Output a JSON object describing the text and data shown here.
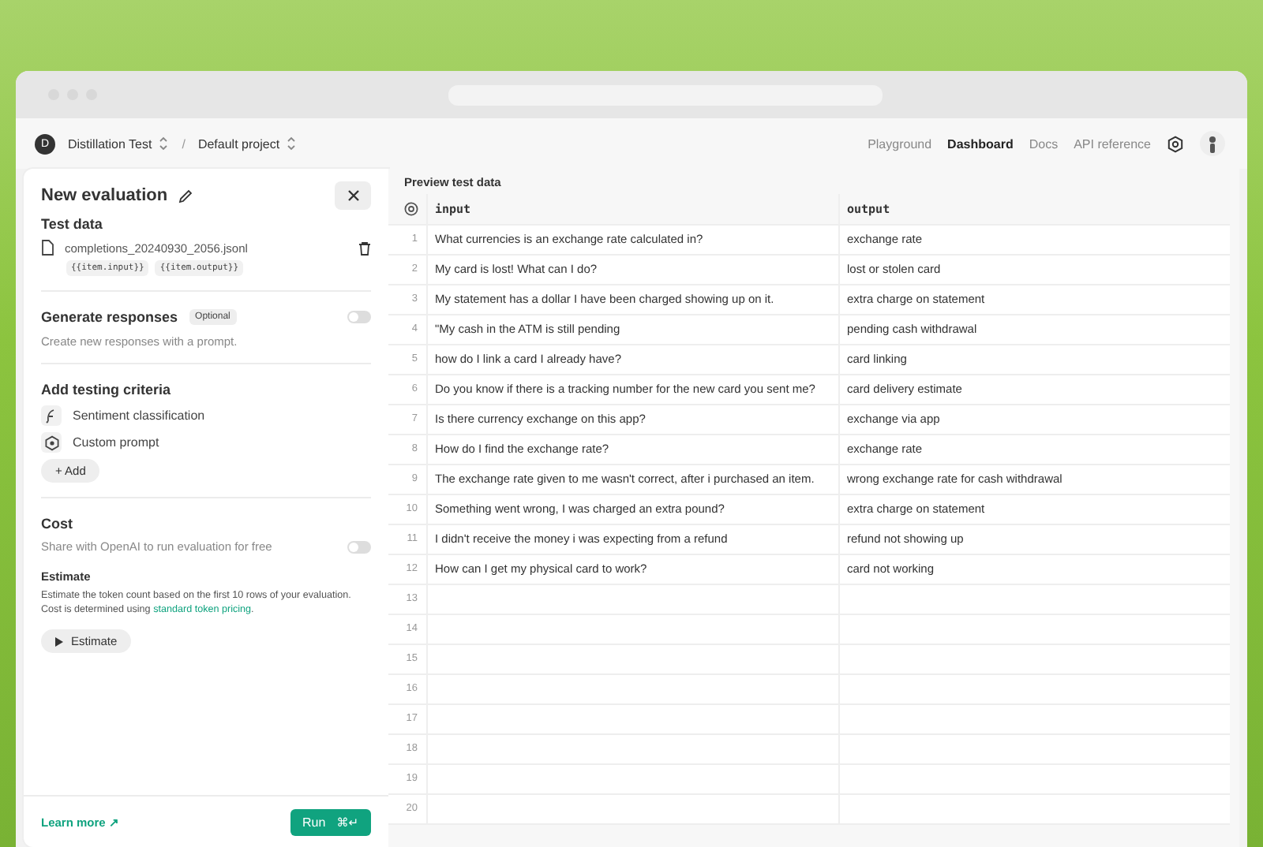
{
  "header": {
    "avatar_letter": "D",
    "organization": "Distillation Test",
    "separator": "/",
    "project": "Default project",
    "nav": [
      {
        "label": "Playground",
        "selected": false
      },
      {
        "label": "Dashboard",
        "selected": true
      },
      {
        "label": "Docs",
        "selected": false
      },
      {
        "label": "API reference",
        "selected": false
      }
    ]
  },
  "panel": {
    "title": "New evaluation",
    "test_data": {
      "heading": "Test data",
      "file": "completions_20240930_2056.jsonl",
      "tags": [
        "{{item.input}}",
        "{{item.output}}"
      ]
    },
    "generate": {
      "heading": "Generate responses",
      "badge": "Optional",
      "on": false,
      "description": "Create new responses with a prompt."
    },
    "criteria": {
      "heading": "Add testing criteria",
      "items": [
        {
          "kind": "sentiment",
          "label": "Sentiment classification"
        },
        {
          "kind": "prompt",
          "label": "Custom prompt"
        }
      ],
      "add_button": "+ Add"
    },
    "cost": {
      "heading": "Cost",
      "share_label": "Share with OpenAI to run evaluation for free",
      "share_on": false,
      "estimate_heading": "Estimate",
      "estimate_text": "Estimate the token count based on the first 10 rows of your evaluation. Cost is determined using ",
      "estimate_link": "standard token pricing",
      "estimate_end": ".",
      "estimate_button": "Estimate"
    },
    "footer": {
      "learn_more": "Learn more ↗",
      "run_button": "Run",
      "run_shortcut": "⌘↵"
    }
  },
  "table": {
    "title": "Preview test data",
    "columns": [
      "input",
      "output"
    ],
    "rows": [
      {
        "number": "1",
        "input": "What currencies is an exchange rate calculated in?",
        "output": "exchange rate"
      },
      {
        "number": "2",
        "input": "My card is lost! What can I do?",
        "output": "lost or stolen card"
      },
      {
        "number": "3",
        "input": "My statement has a dollar I have been charged showing up on it.",
        "output": "extra charge on statement"
      },
      {
        "number": "4",
        "input": "\"My cash in the ATM is still pending",
        "output": "pending cash withdrawal"
      },
      {
        "number": "5",
        "input": "how do I link a card I already have?",
        "output": "card linking"
      },
      {
        "number": "6",
        "input": "Do you know if there is a tracking number for the new card you sent me?",
        "output": "card delivery estimate"
      },
      {
        "number": "7",
        "input": "Is there currency exchange on this app?",
        "output": "exchange via app"
      },
      {
        "number": "8",
        "input": "How do I find the exchange rate?",
        "output": "exchange rate"
      },
      {
        "number": "9",
        "input": "The exchange rate given to me wasn't correct, after i purchased an item.",
        "output": "wrong exchange rate for cash withdrawal"
      },
      {
        "number": "10",
        "input": "Something went wrong, I was charged an extra pound?",
        "output": "extra charge on statement"
      },
      {
        "number": "11",
        "input": "I didn't receive the money i was expecting from a refund",
        "output": "refund not showing up"
      },
      {
        "number": "12",
        "input": "How can I get my physical card to work?",
        "output": "card not working"
      },
      {
        "number": "13"
      },
      {
        "number": "14"
      },
      {
        "number": "15"
      },
      {
        "number": "16"
      },
      {
        "number": "17"
      },
      {
        "number": "18"
      },
      {
        "number": "19"
      },
      {
        "number": "20"
      }
    ]
  }
}
